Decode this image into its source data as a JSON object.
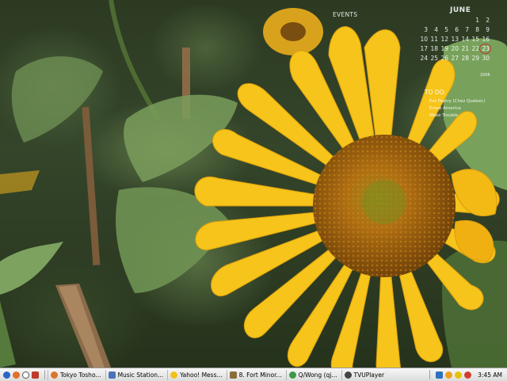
{
  "desktop": {
    "events_widget": {
      "title": "EVENTS",
      "month": "JUNE",
      "calendar_rows": [
        [
          "",
          "",
          "",
          "",
          "",
          "1",
          "2"
        ],
        [
          "3",
          "4",
          "5",
          "6",
          "7",
          "8",
          "9"
        ],
        [
          "10",
          "11",
          "12",
          "13",
          "14",
          "15",
          "16"
        ],
        [
          "17",
          "18",
          "19",
          "20",
          "21",
          "22",
          "23"
        ],
        [
          "24",
          "25",
          "26",
          "27",
          "28",
          "29",
          "30"
        ]
      ],
      "today": "23",
      "year": "2006",
      "todo_title": "TO DO:",
      "todo_items": [
        "Eat Pastry (Chez Quebec)",
        "Erase America",
        "Make Trouble"
      ]
    }
  },
  "taskbar": {
    "quick_launch": [
      "finder-icon",
      "firefox-icon",
      "chat-icon",
      "media-icon"
    ],
    "tasks": [
      {
        "label": "Tokyo Tosho...",
        "icon": "firefox-icon",
        "color": "#d9772c"
      },
      {
        "label": "Music Station...",
        "icon": "window-icon",
        "color": "#4a74b5"
      },
      {
        "label": "Yahoo! Mess...",
        "icon": "smiley-icon",
        "color": "#f2c21b"
      },
      {
        "label": "8. Fort Minor...",
        "icon": "music-icon",
        "color": "#8a6d3b"
      },
      {
        "label": "Q/Wong (qj...",
        "icon": "chat-icon",
        "color": "#3a9a4a"
      },
      {
        "label": "TVUPlayer",
        "icon": "tv-icon",
        "color": "#444444"
      }
    ],
    "tray": [
      "network-icon",
      "messenger-icon",
      "volume-icon",
      "update-icon"
    ],
    "clock": "3:45 AM"
  }
}
